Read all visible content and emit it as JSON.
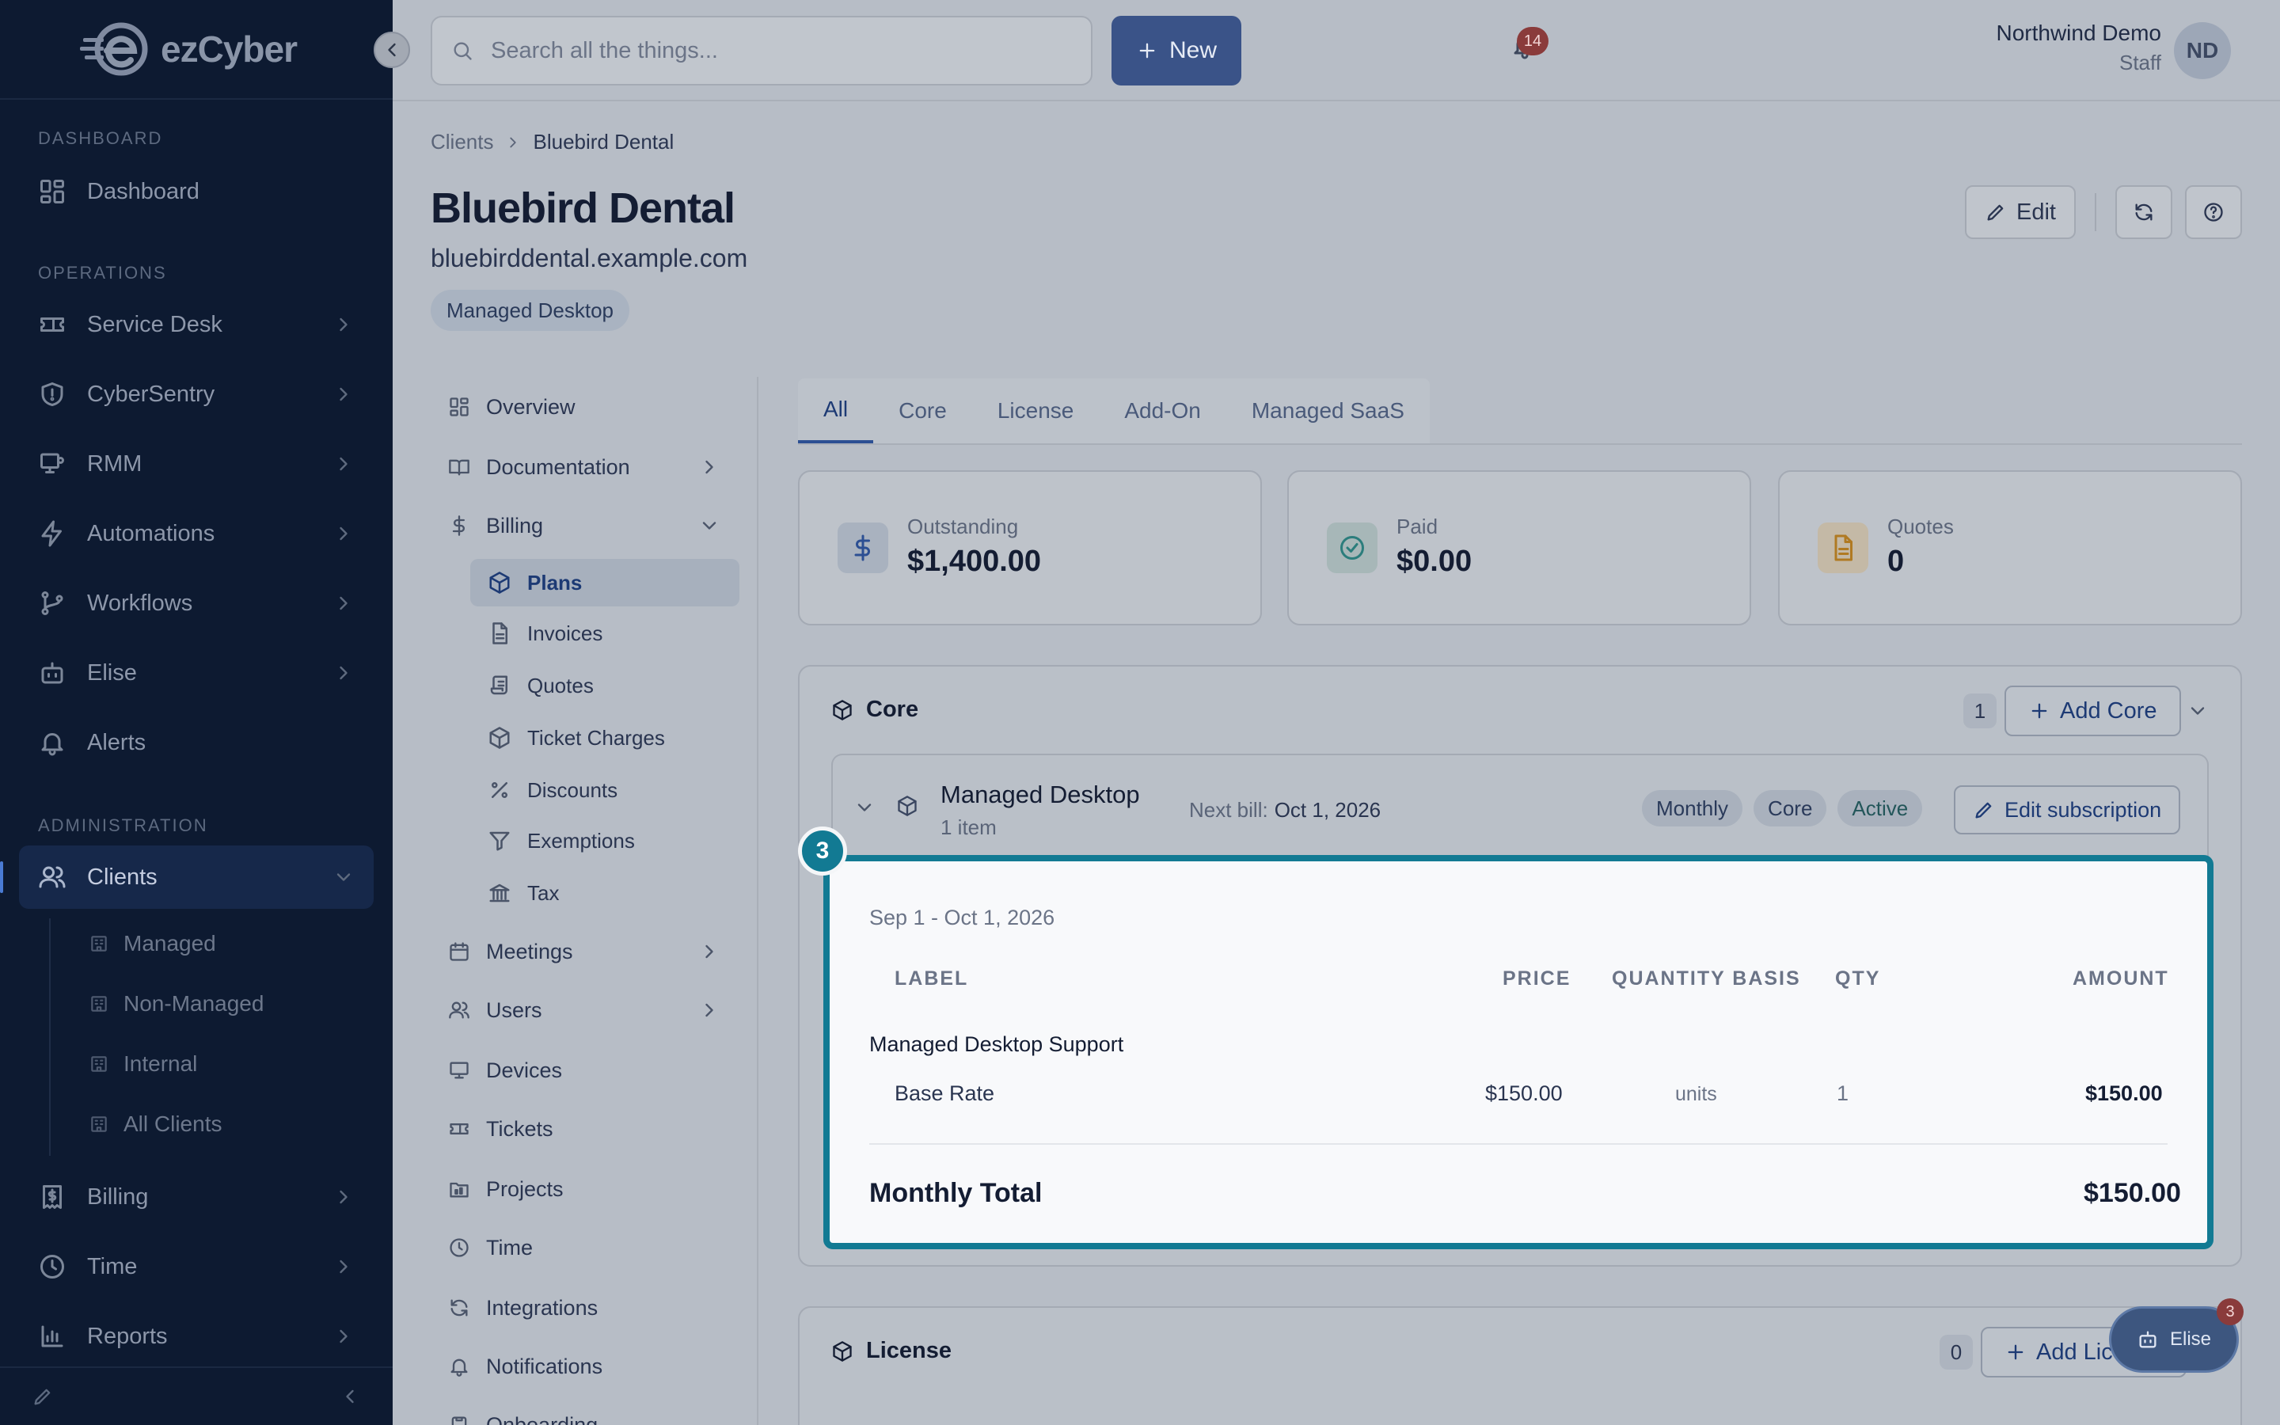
{
  "app": {
    "brand": "ezCyber",
    "accent": "#3a5388",
    "highlight": "#127a93"
  },
  "sidebar": {
    "sections": {
      "dashboard": "DASHBOARD",
      "operations": "OPERATIONS",
      "administration": "ADMINISTRATION"
    },
    "items": {
      "dashboard": "Dashboard",
      "service_desk": "Service Desk",
      "cybersentry": "CyberSentry",
      "rmm": "RMM",
      "automations": "Automations",
      "workflows": "Workflows",
      "elise": "Elise",
      "alerts": "Alerts",
      "clients": "Clients",
      "billing": "Billing",
      "time": "Time",
      "reports": "Reports"
    },
    "client_sub": {
      "managed": "Managed",
      "non_managed": "Non-Managed",
      "internal": "Internal",
      "all": "All Clients"
    }
  },
  "topbar": {
    "search_placeholder": "Search all the things...",
    "new_label": "New",
    "notif_count": "14",
    "user_name": "Northwind Demo",
    "user_role": "Staff",
    "avatar": "ND"
  },
  "breadcrumb": {
    "root": "Clients",
    "current": "Bluebird Dental"
  },
  "client": {
    "name": "Bluebird Dental",
    "domain": "bluebirddental.example.com",
    "tag": "Managed Desktop"
  },
  "header_actions": {
    "edit": "Edit"
  },
  "subnav": {
    "overview": "Overview",
    "documentation": "Documentation",
    "billing": "Billing",
    "billing_sub": {
      "plans": "Plans",
      "invoices": "Invoices",
      "quotes": "Quotes",
      "ticket_charges": "Ticket Charges",
      "discounts": "Discounts",
      "exemptions": "Exemptions",
      "tax": "Tax"
    },
    "meetings": "Meetings",
    "users": "Users",
    "devices": "Devices",
    "tickets": "Tickets",
    "projects": "Projects",
    "time": "Time",
    "integrations": "Integrations",
    "notifications": "Notifications",
    "onboarding": "Onboarding"
  },
  "tabs": {
    "all": "All",
    "core": "Core",
    "license": "License",
    "addon": "Add-On",
    "saas": "Managed SaaS"
  },
  "stats": {
    "outstanding": {
      "label": "Outstanding",
      "value": "$1,400.00"
    },
    "paid": {
      "label": "Paid",
      "value": "$0.00"
    },
    "quotes": {
      "label": "Quotes",
      "value": "0"
    }
  },
  "core": {
    "title": "Core",
    "count": "1",
    "add_label": "Add Core",
    "plan": {
      "name": "Managed Desktop",
      "items": "1 item",
      "next_bill_label": "Next bill:",
      "next_bill_date": "Oct 1, 2026",
      "pills": {
        "freq": "Monthly",
        "type": "Core",
        "status": "Active"
      },
      "edit_label": "Edit subscription"
    },
    "detail": {
      "step": "3",
      "period": "Sep 1 - Oct 1, 2026",
      "headers": {
        "label": "LABEL",
        "price": "PRICE",
        "basis": "QUANTITY BASIS",
        "qty": "QTY",
        "amount": "AMOUNT"
      },
      "group": "Managed Desktop Support",
      "row": {
        "label": "Base Rate",
        "price": "$150.00",
        "basis": "units",
        "qty": "1",
        "amount": "$150.00"
      },
      "total_label": "Monthly Total",
      "total_value": "$150.00"
    }
  },
  "license": {
    "title": "License",
    "count": "0",
    "add_label": "Add License"
  },
  "elise_chat": {
    "label": "Elise",
    "badge": "3"
  }
}
